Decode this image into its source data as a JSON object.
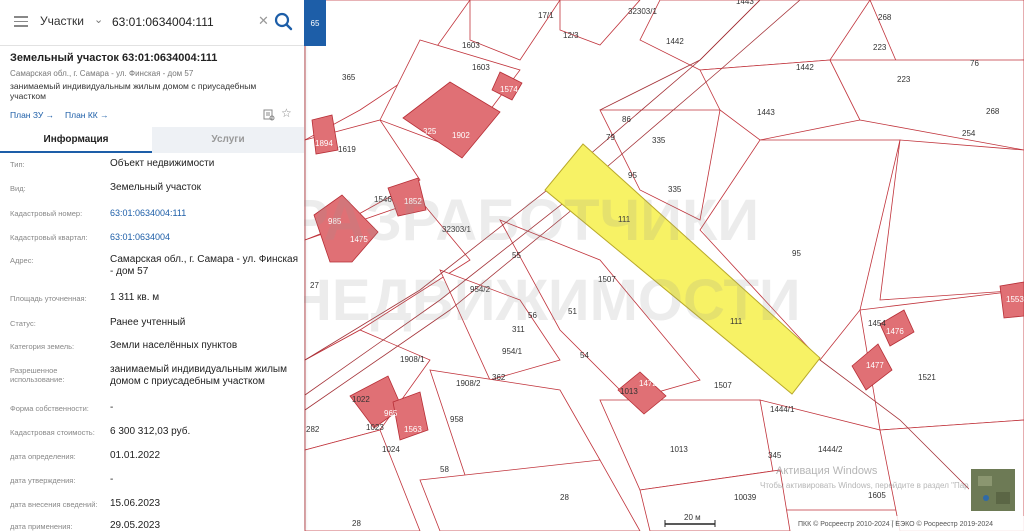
{
  "search": {
    "layer": "Участки",
    "value": "63:01:0634004:111"
  },
  "collapse_label": "65",
  "object": {
    "title": "Земельный участок 63:01:0634004:111",
    "address": "Самарская обл., г. Самара - ул. Финская - дом 57",
    "description": "занимаемый индивидуальным жилым домом с приусадебным участком",
    "plan_zu": "План ЗУ →",
    "plan_kk": "План КК →"
  },
  "tabs": {
    "info": "Информация",
    "services": "Услуги"
  },
  "fields": [
    {
      "key": "Тип:",
      "value": "Объект недвижимости"
    },
    {
      "key": "Вид:",
      "value": "Земельный участок"
    },
    {
      "key": "Кадастровый номер:",
      "value": "63:01:0634004:111"
    },
    {
      "key": "Кадастровый квартал:",
      "value": "63:01:0634004"
    },
    {
      "key": "Адрес:",
      "value": "Самарская обл., г. Самара - ул. Финская - дом 57"
    },
    {
      "key": "Площадь уточненная:",
      "value": "1 311 кв. м"
    },
    {
      "key": "Статус:",
      "value": "Ранее учтенный"
    },
    {
      "key": "Категория земель:",
      "value": "Земли населённых пунктов"
    },
    {
      "key": "Разрешенное использование:",
      "value": "занимаемый индивидуальным жилым домом с приусадебным участком"
    },
    {
      "key": "Форма собственности:",
      "value": "-"
    },
    {
      "key": "Кадастровая стоимость:",
      "value": "6 300 312,03 руб."
    },
    {
      "key": "дата определения:",
      "value": "01.01.2022"
    },
    {
      "key": "дата утверждения:",
      "value": "-"
    },
    {
      "key": "дата внесения сведений:",
      "value": "15.06.2023"
    },
    {
      "key": "дата применения:",
      "value": "29.05.2023"
    }
  ],
  "map": {
    "parcel_labels": [
      "1603",
      "17/1",
      "12/3",
      "32303/1",
      "1443",
      "268",
      "1442",
      "223",
      "76",
      "365",
      "1603",
      "1574",
      "1442",
      "223",
      "268",
      "325",
      "1902",
      "79",
      "86",
      "335",
      "1443",
      "254",
      "1894",
      "1619",
      "95",
      "335",
      "1546",
      "1852",
      "985",
      "1475",
      "32303/1",
      "111",
      "95",
      "55",
      "1507",
      "27",
      "954/2",
      "56",
      "51",
      "111",
      "1553",
      "311",
      "1454",
      "1476",
      "954/1",
      "54",
      "1908/1",
      "1908/2",
      "362",
      "1472",
      "1013",
      "1507",
      "1477",
      "1521",
      "1022",
      "965",
      "958",
      "1444/1",
      "1023",
      "1024",
      "1563",
      "282",
      "1013",
      "345",
      "1444/2",
      "58",
      "10039",
      "1605",
      "28",
      "28",
      "76"
    ],
    "selected_label": "111",
    "scale": "20 м",
    "watermark": "Активация Windows",
    "watermark_sub": "Чтобы активировать Windows, перейдите в раздел \"Параметры\".",
    "copyright": "ПКК © Росреестр 2010-2024 | ЕЭКО © Росреестр 2019-2024",
    "logo_wm_1": "РАЗРАБОТЧИКИ",
    "logo_wm_2": "НЕДВИЖИМОСТИ"
  },
  "colors": {
    "accent": "#1d5ea8",
    "selected": "#f7f265",
    "building": "#e07075",
    "border": "#c0333b"
  },
  "icons": [
    "menu-icon",
    "chevron-down-icon",
    "close-icon",
    "search-icon",
    "document-icon",
    "star-icon"
  ]
}
